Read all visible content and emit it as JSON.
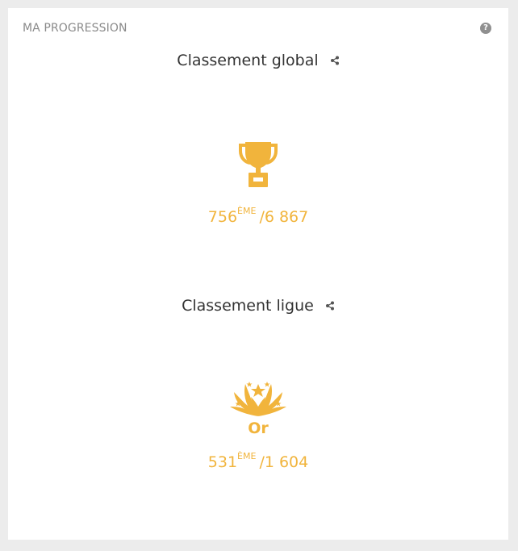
{
  "card": {
    "title": "MA PROGRESSION",
    "help_glyph": "?"
  },
  "global": {
    "heading": "Classement global",
    "icon": "trophy-icon",
    "rank": "756",
    "suffix": "ÈME",
    "total": "/6 867"
  },
  "league": {
    "heading": "Classement ligue",
    "icon": "gold-league-badge-icon",
    "tier": "Or",
    "rank": "531",
    "suffix": "ÈME",
    "total": "/1 604"
  },
  "colors": {
    "accent": "#f1b43c",
    "heading": "#333333",
    "muted": "#8a8a8a",
    "background": "#ececec",
    "card": "#ffffff"
  }
}
